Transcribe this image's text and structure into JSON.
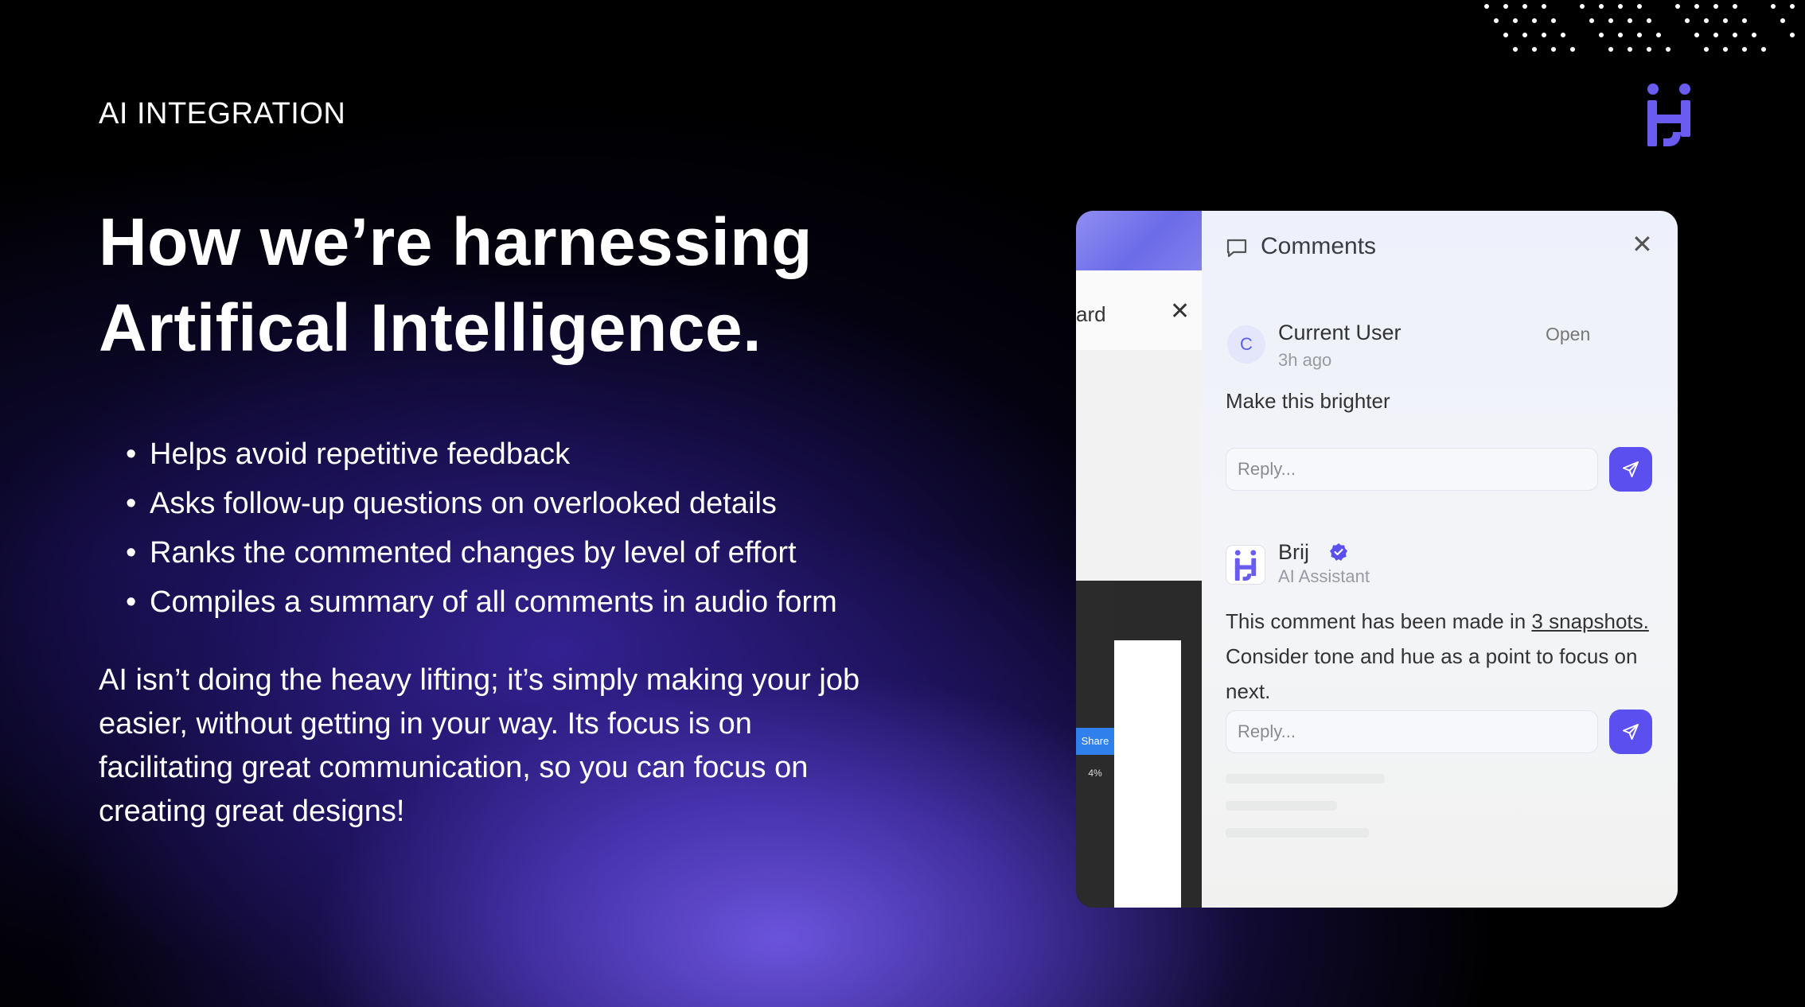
{
  "slide": {
    "eyebrow": "AI INTEGRATION",
    "headline_line1": "How we’re harnessing",
    "headline_line2": "Artifical Intelligence.",
    "bullets": [
      "Helps avoid repetitive feedback",
      "Asks follow-up questions on overlooked details",
      "Ranks the commented changes by level of effort",
      "Compiles a summary of all comments in audio form"
    ],
    "paragraph": "AI isn’t doing the heavy lifting; it’s simply making your job easier, without getting in your way. Its focus is on facilitating great communication, so you can focus on creating great designs!"
  },
  "design_tool": {
    "tab_label": "ard",
    "share_label": "Share",
    "zoom_label": "4%"
  },
  "comments_panel": {
    "title": "Comments",
    "thread": {
      "avatar_initial": "C",
      "author": "Current User",
      "time": "3h ago",
      "status": "Open",
      "text": "Make this brighter",
      "reply_placeholder": "Reply..."
    },
    "ai_reply": {
      "author": "Brij",
      "role": "AI Assistant",
      "text_before_link": "This comment has been made in ",
      "link_text": "3 snapshots.",
      "text_after_link": " Consider tone and hue as a point to focus on next.",
      "reply_placeholder": "Reply..."
    }
  },
  "colors": {
    "accent": "#5b4ff0",
    "logo_purple": "#6a5cf0",
    "background": "#000000"
  }
}
